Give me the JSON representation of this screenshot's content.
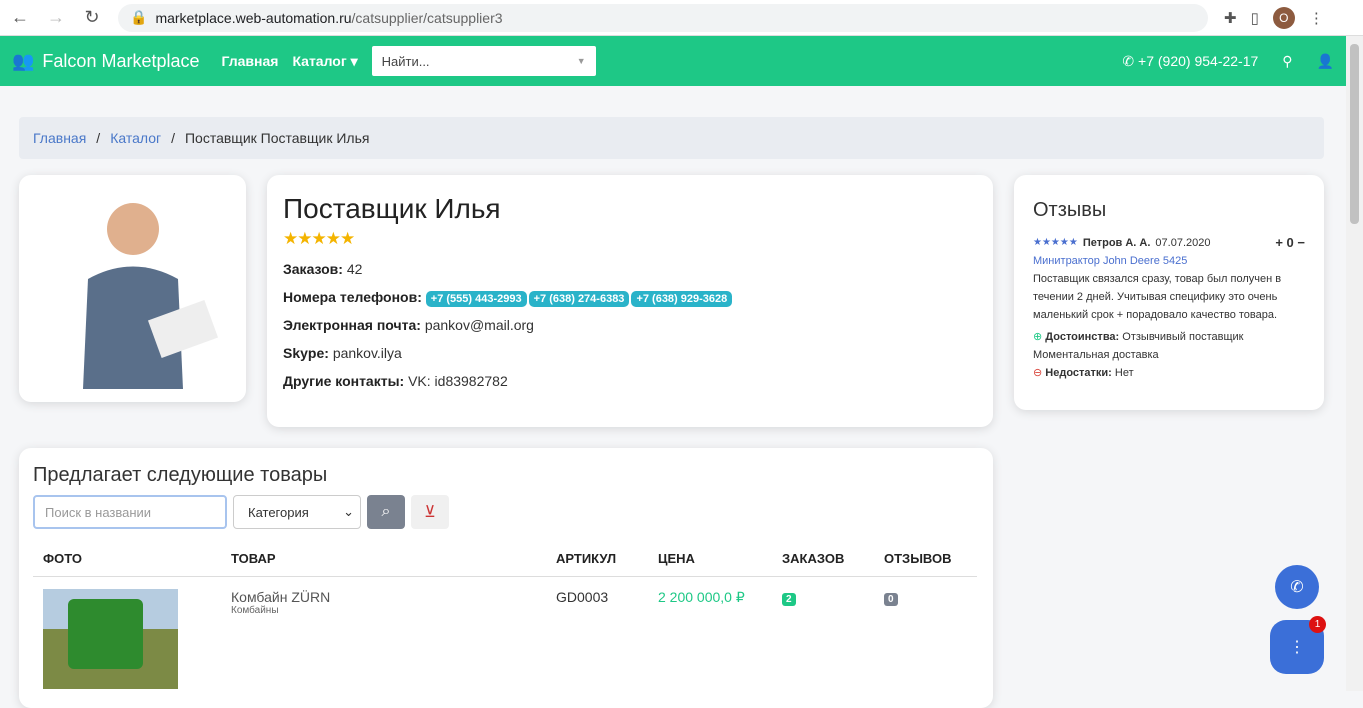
{
  "browser": {
    "url_host": "marketplace.web-automation.ru",
    "url_path": "/catsupplier/catsupplier3",
    "avatar": "O"
  },
  "nav": {
    "brand": "Falcon Marketplace",
    "home": "Главная",
    "catalog": "Каталог",
    "search_placeholder": "Найти...",
    "phone": "+7 (920) 954-22-17"
  },
  "breadcrumb": {
    "home": "Главная",
    "catalog": "Каталог",
    "current": "Поставщик Поставщик Илья"
  },
  "supplier": {
    "name": "Поставщик Илья",
    "stars": "★★★★★",
    "orders_label": "Заказов:",
    "orders": "42",
    "phones_label": "Номера телефонов:",
    "phones": [
      "+7 (555) 443-2993",
      "+7 (638) 274-6383",
      "+7 (638) 929-3628"
    ],
    "email_label": "Электронная почта:",
    "email": "pankov@mail.org",
    "skype_label": "Skype:",
    "skype": "pankov.ilya",
    "other_label": "Другие контакты:",
    "other": "VK: id83982782"
  },
  "reviews": {
    "title": "Отзывы",
    "items": [
      {
        "stars": "★★★★★",
        "author": "Петров А. А.",
        "date": "07.07.2020",
        "votes": "0",
        "product": "Минитрактор John Deere 5425",
        "text": "Поставщик связался сразу, товар был получен в течении 2 дней. Учитывая специфику это очень маленький срок + порадовало качество товара.",
        "pros_label": "Достоинства:",
        "pros": "Отзывчивый поставщик Моментальная доставка",
        "cons_label": "Недостатки:",
        "cons": "Нет"
      }
    ]
  },
  "products": {
    "title": "Предлагает следующие товары",
    "search_placeholder": "Поиск в названии",
    "category": "Категория",
    "columns": [
      "ФОТО",
      "ТОВАР",
      "АРТИКУЛ",
      "ЦЕНА",
      "ЗАКАЗОВ",
      "ОТЗЫВОВ"
    ],
    "rows": [
      {
        "name": "Комбайн ZÜRN",
        "category": "Комбайны",
        "sku": "GD0003",
        "price": "2 200 000,0 ₽",
        "orders": "2",
        "reviews": "0"
      }
    ]
  },
  "chat": {
    "badge": "1"
  },
  "colors": {
    "brand": "#1ec886",
    "badge": "#2ab3c9",
    "link": "#4a78c9"
  }
}
